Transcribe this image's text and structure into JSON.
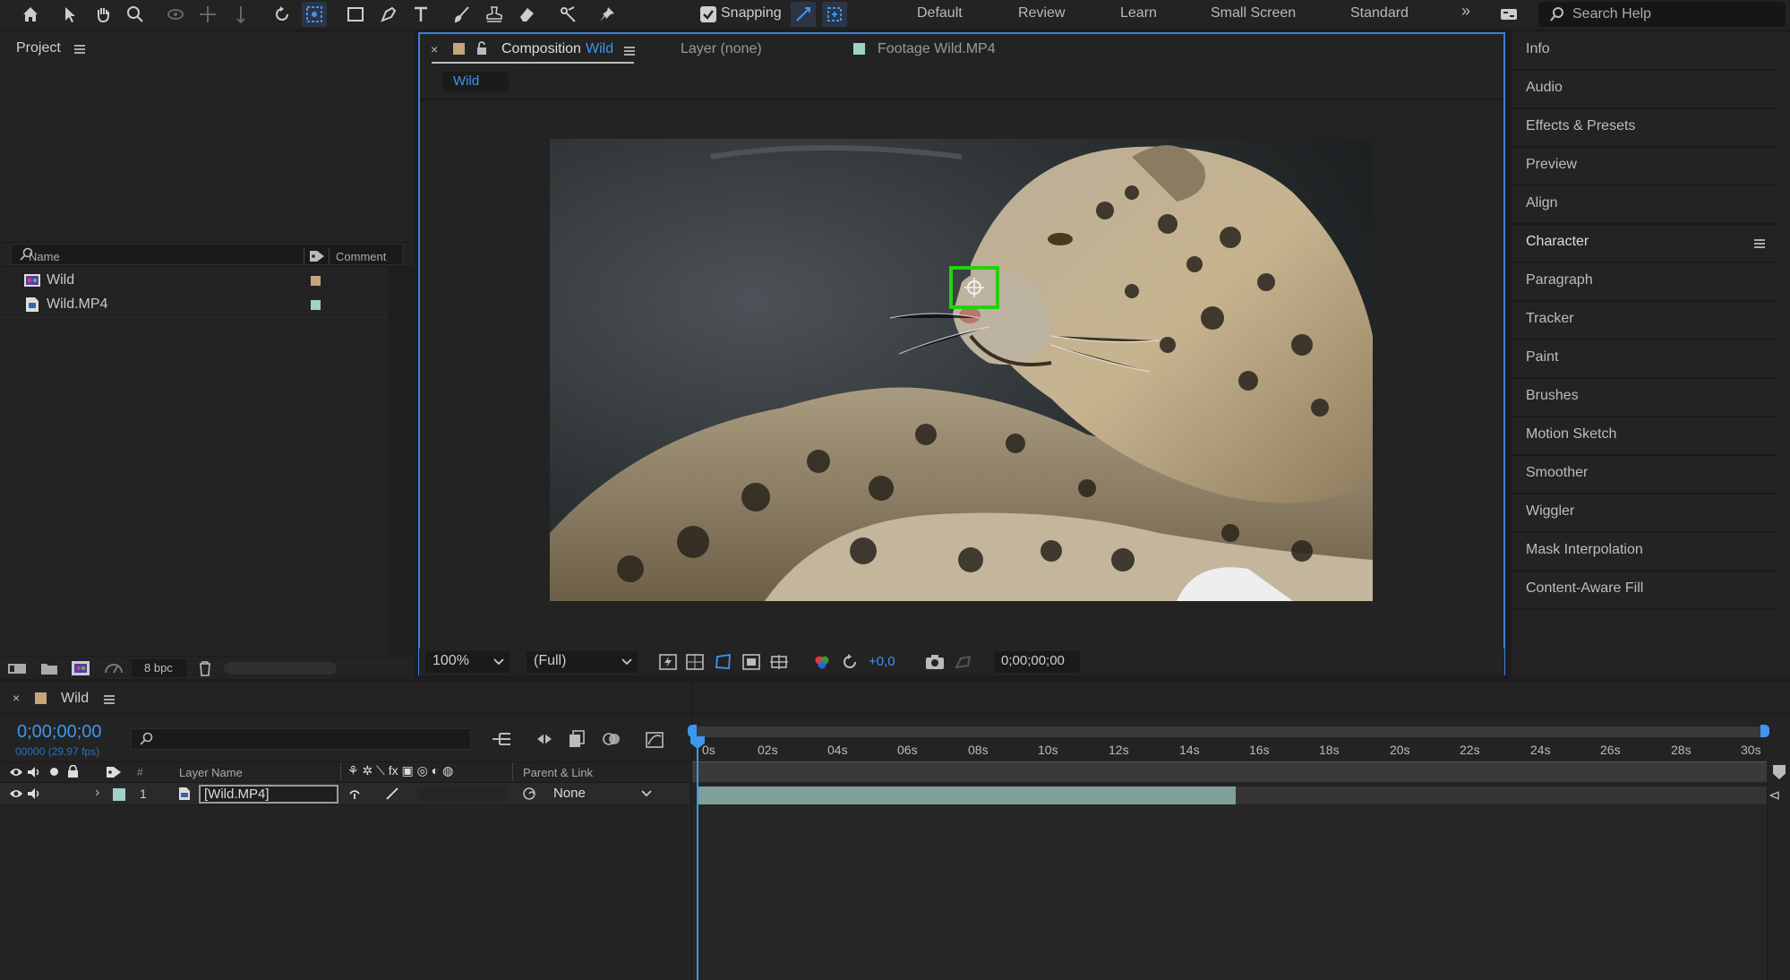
{
  "toolbar": {
    "snapping_label": "Snapping",
    "workspaces": [
      "Default",
      "Review",
      "Learn",
      "Small Screen",
      "Standard"
    ],
    "search_placeholder": "Search Help"
  },
  "project": {
    "title": "Project",
    "columns": {
      "name": "Name",
      "comment": "Comment"
    },
    "items": [
      {
        "name": "Wild",
        "color": "#c7a57c"
      },
      {
        "name": "Wild.MP4",
        "color": "#9fd1c9"
      }
    ],
    "bpc": "8 bpc"
  },
  "composition": {
    "tab_prefix": "Composition",
    "tab_name": "Wild",
    "layer_tab": "Layer (none)",
    "footage_tab": "Footage Wild.MP4",
    "breadcrumb": "Wild",
    "zoom": "100%",
    "resolution": "(Full)",
    "exposure": "+0,0",
    "timecode": "0;00;00;00"
  },
  "right_panel": {
    "items": [
      "Info",
      "Audio",
      "Effects & Presets",
      "Preview",
      "Align",
      "Character",
      "Paragraph",
      "Tracker",
      "Paint",
      "Brushes",
      "Motion Sketch",
      "Smoother",
      "Wiggler",
      "Mask Interpolation",
      "Content-Aware Fill"
    ]
  },
  "timeline": {
    "tab_name": "Wild",
    "timecode": "0;00;00;00",
    "frame_info": "00000 (29.97 fps)",
    "columns": {
      "num": "#",
      "layer_name": "Layer Name",
      "parent": "Parent & Link"
    },
    "layers": [
      {
        "num": "1",
        "name": "[Wild.MP4]",
        "parent": "None",
        "color": "#9fd1c9"
      }
    ],
    "ruler": [
      "0s",
      "02s",
      "04s",
      "06s",
      "08s",
      "10s",
      "12s",
      "14s",
      "16s",
      "18s",
      "20s",
      "22s",
      "24s",
      "26s",
      "28s",
      "30s"
    ]
  },
  "colors": {
    "accent": "#3b7ed8",
    "timecode_blue": "#3d96f0",
    "tracker_green": "#25d10f",
    "clip_bar": "#7e9f9a"
  }
}
